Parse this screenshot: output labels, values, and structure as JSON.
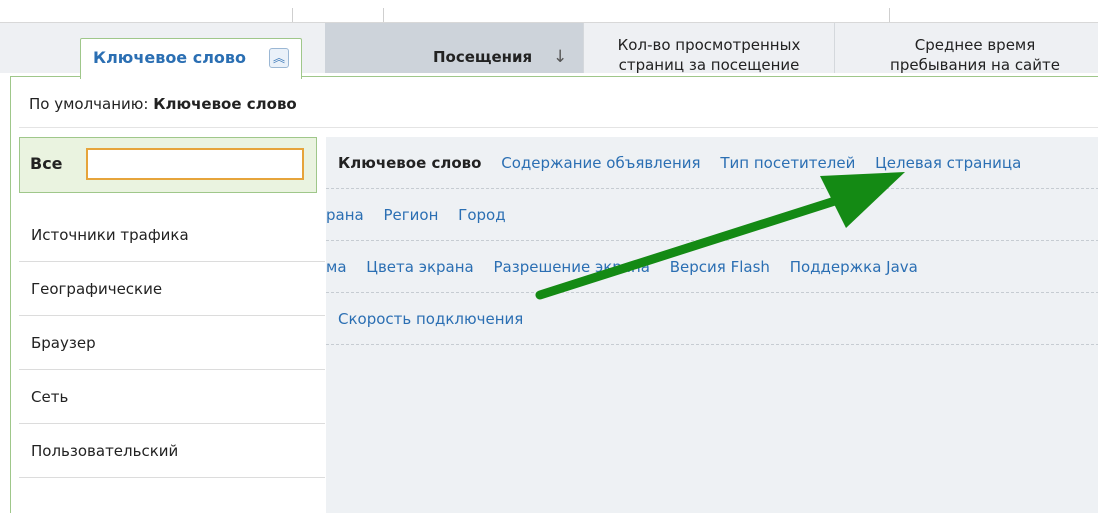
{
  "table_header": {
    "keyword_tab": {
      "label": "Ключевое слово",
      "icon": "chevron-double-up-icon"
    },
    "columns": [
      {
        "label": "Посещения",
        "sorted": true,
        "sort_icon": "arrow-down-icon"
      },
      {
        "label": "Кол-во просмотренных страниц за посещение"
      },
      {
        "label": "Среднее время пребывания на сайте"
      }
    ]
  },
  "popup": {
    "default_prefix": "По умолчанию:",
    "default_value": "Ключевое слово",
    "left_menu": {
      "all_label": "Все",
      "search_value": "",
      "items": [
        {
          "label": "Источники трафика"
        },
        {
          "label": "Географические"
        },
        {
          "label": "Браузер"
        },
        {
          "label": "Сеть"
        },
        {
          "label": "Пользовательский"
        }
      ]
    },
    "content_rows": [
      [
        "Ключевое слово",
        "Содержание объявления",
        "Тип посетителей",
        "Целевая страница"
      ],
      [
        "рана",
        "Регион",
        "Город"
      ],
      [
        "ма",
        "Цвета экрана",
        "Разрешение экрана",
        "Версия Flash",
        "Поддержка Java"
      ],
      [
        "Скорость подключения"
      ]
    ]
  },
  "colors": {
    "accent_green": "#9fc78a",
    "link_blue": "#2b6fb3",
    "input_border": "#e6a43b",
    "arrow_green": "#148a14"
  }
}
